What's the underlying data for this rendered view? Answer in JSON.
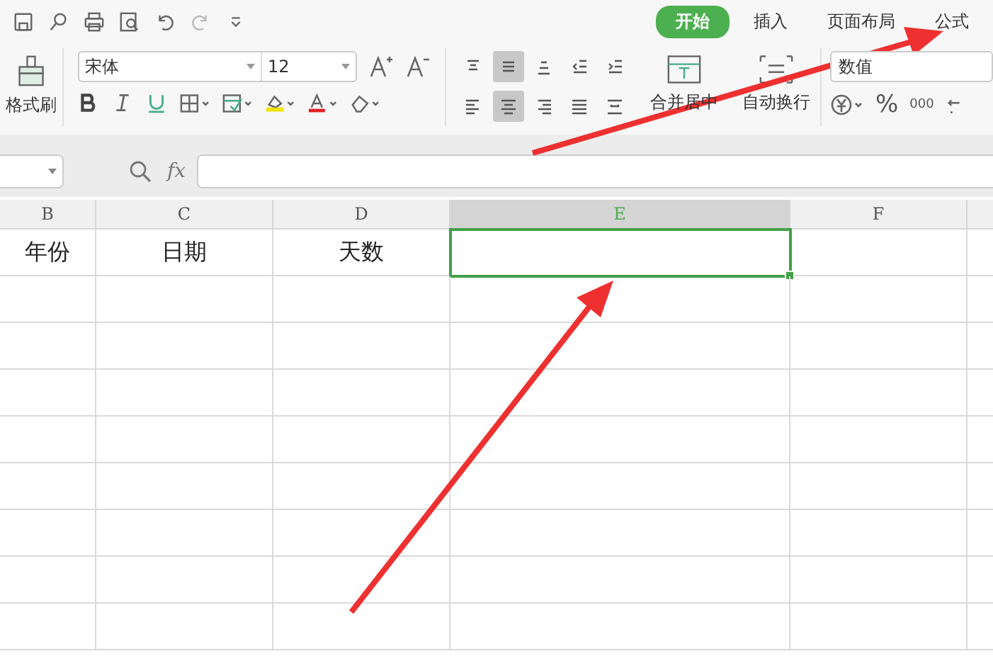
{
  "tabs": [
    {
      "label": "开始",
      "selected": true
    },
    {
      "label": "插入",
      "selected": false
    },
    {
      "label": "页面布局",
      "selected": false
    },
    {
      "label": "公式",
      "selected": false
    }
  ],
  "ribbon": {
    "format_painter": "格式刷",
    "font_name": "宋体",
    "font_size": "12",
    "number_format": "数值",
    "merge_label": "合并居中",
    "wrap_label": "自动换行",
    "percent": "%",
    "thousands": "000",
    "align_top_row": [
      {
        "kind": "top",
        "selected": false
      },
      {
        "kind": "middle",
        "selected": true
      },
      {
        "kind": "bottom",
        "selected": false
      },
      {
        "kind": "outdent",
        "selected": false
      },
      {
        "kind": "indent",
        "selected": false
      }
    ],
    "align_bottom_row": [
      {
        "kind": "left",
        "selected": false
      },
      {
        "kind": "center",
        "selected": true
      },
      {
        "kind": "right",
        "selected": false
      },
      {
        "kind": "justify",
        "selected": false
      },
      {
        "kind": "distribute",
        "selected": false
      }
    ]
  },
  "formula_bar": {
    "fx": "fx"
  },
  "sheet": {
    "columns": [
      {
        "label": "B",
        "selected": false
      },
      {
        "label": "C",
        "selected": false
      },
      {
        "label": "D",
        "selected": false
      },
      {
        "label": "E",
        "selected": true
      },
      {
        "label": "F",
        "selected": false
      }
    ],
    "rows": [
      [
        "年份",
        "日期",
        "天数"
      ]
    ]
  }
}
